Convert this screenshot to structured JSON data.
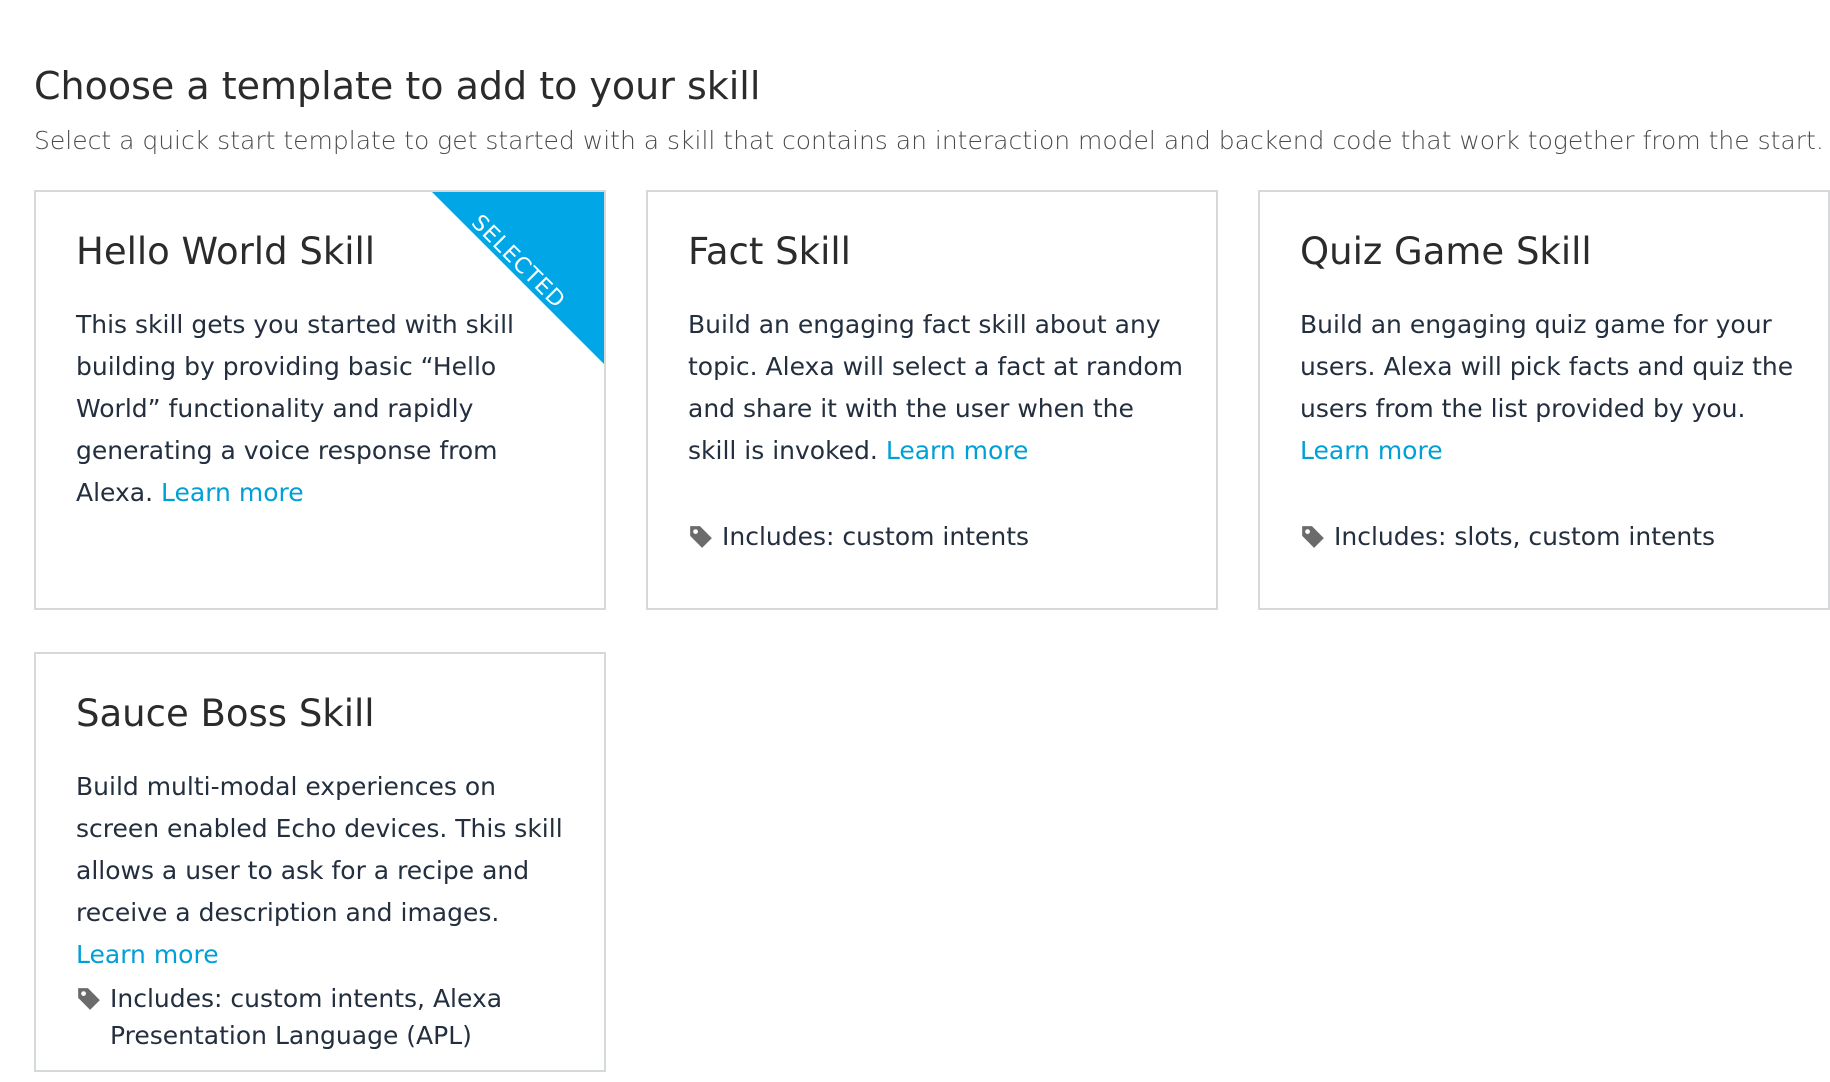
{
  "page": {
    "title": "Choose a template to add to your skill",
    "subtitle": "Select a quick start template to get started with a skill that contains an interaction model and backend code that work together from the start."
  },
  "colors": {
    "accent": "#00a6e6",
    "link": "#00a0d6",
    "border": "#d5d9d9",
    "tag_icon": "#6b6b6b"
  },
  "icons": {
    "tag": "tag-icon"
  },
  "templates": [
    {
      "title": "Hello World Skill",
      "description": "This skill gets you started with skill building by providing basic “Hello World” functionality and rapidly generating a voice response from Alexa.",
      "learn_more": "Learn more",
      "includes": "",
      "selected": true,
      "badge": "SELECTED"
    },
    {
      "title": "Fact Skill",
      "description": "Build an engaging fact skill about any topic. Alexa will select a fact at random and share it with the user when the skill is invoked.",
      "learn_more": "Learn more",
      "includes": "Includes: custom intents",
      "selected": false
    },
    {
      "title": "Quiz Game Skill",
      "description": "Build an engaging quiz game for your users. Alexa will pick facts and quiz the users from the list provided by you.",
      "learn_more": "Learn more",
      "includes": "Includes: slots, custom intents",
      "selected": false
    },
    {
      "title": "Sauce Boss Skill",
      "description": "Build multi-modal experiences on screen enabled Echo devices. This skill allows a user to ask for a recipe and receive a description and images.",
      "learn_more": "Learn more",
      "includes": "Includes: custom intents, Alexa Presentation Language (APL)",
      "selected": false
    }
  ]
}
